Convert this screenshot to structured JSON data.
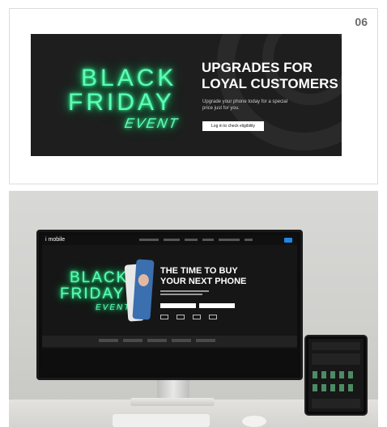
{
  "card": {
    "index": "06",
    "banner": {
      "neon_line1": "BLACK",
      "neon_line2": "FRIDAY",
      "neon_line3": "EVENT",
      "title": "UPGRADES FOR LOYAL CUSTOMERS",
      "subtitle": "Upgrade your phone today for a special price just for you.",
      "button_label": "Log in to check eligibility",
      "colors": {
        "neon": "#5dffb8",
        "background": "#1e1e1e"
      }
    }
  },
  "mockup": {
    "site_logo": "i mobile",
    "hero": {
      "neon_line1": "BLACK",
      "neon_line2": "FRIDAY",
      "neon_line3": "EVENT",
      "title": "THE TIME TO BUY YOUR NEXT PHONE"
    },
    "colors": {
      "accent": "#1e88e5"
    }
  }
}
